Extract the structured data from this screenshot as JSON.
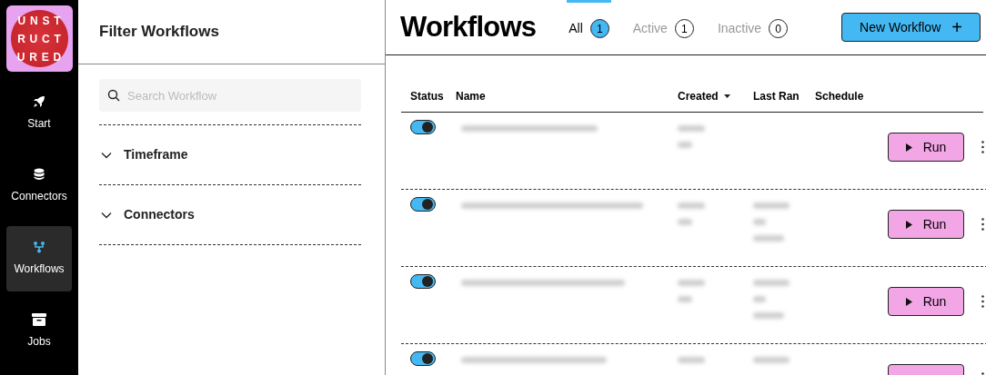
{
  "logo": {
    "lines": [
      "UNST",
      "RUCT",
      "URED"
    ]
  },
  "nav": [
    {
      "label": "Start",
      "selected": false
    },
    {
      "label": "Connectors",
      "selected": false
    },
    {
      "label": "Workflows",
      "selected": true
    },
    {
      "label": "Jobs",
      "selected": false
    }
  ],
  "filter": {
    "title": "Filter Workflows",
    "search": {
      "placeholder": "Search Workflow"
    },
    "sections": [
      {
        "label": "Timeframe",
        "expanded": false
      },
      {
        "label": "Connectors",
        "expanded": false
      }
    ]
  },
  "main": {
    "title": "Workflows",
    "tabs": [
      {
        "label": "All",
        "count": "1",
        "selected": true
      },
      {
        "label": "Active",
        "count": "1",
        "selected": false
      },
      {
        "label": "Inactive",
        "count": "0",
        "selected": false
      }
    ],
    "new_button": "New Workflow",
    "new_icon": "+"
  },
  "table": {
    "columns": [
      "Status",
      "Name",
      "Created",
      "Last Ran",
      "Schedule"
    ],
    "rows": [
      {
        "on": true,
        "run": "Run"
      },
      {
        "on": true,
        "run": "Run"
      },
      {
        "on": true,
        "run": "Run"
      },
      {
        "on": true
      }
    ]
  }
}
